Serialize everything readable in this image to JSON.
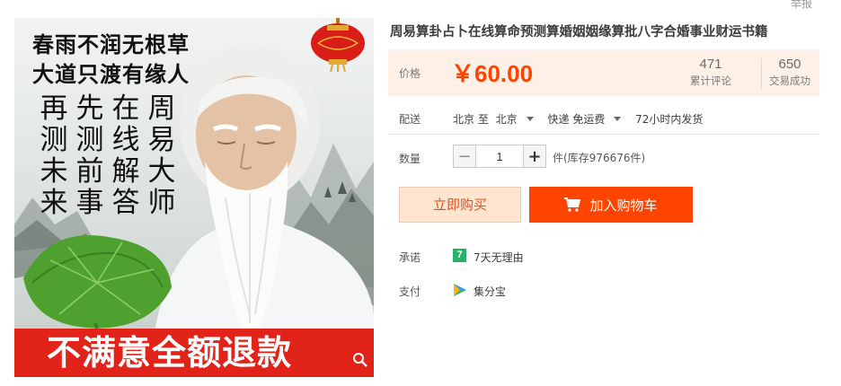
{
  "header": {
    "report_link": "举报"
  },
  "image": {
    "slogan_lines": [
      "春雨不润无根草",
      "大道只渡有缘人"
    ],
    "poem_columns": [
      "再测未来",
      "先测前事",
      "在线解答",
      "周易大师"
    ],
    "banner": "不满意全额退款",
    "icons": [
      "lantern-icon",
      "zoom-icon"
    ]
  },
  "product": {
    "title": "周易算卦占卜在线算命预测算婚姻姻缘算批八字合婚事业财运书籍",
    "price_label": "价格",
    "price": "￥60.00",
    "reviews_count": "471",
    "reviews_label": "累计评论",
    "sales_count": "650",
    "sales_label": "交易成功"
  },
  "shipping": {
    "label": "配送",
    "from": "北京 至",
    "to": "北京",
    "method": "快递 免运费",
    "dispatch": "72小时内发货"
  },
  "quantity": {
    "label": "数量",
    "minus": "−",
    "value": "1",
    "plus": "+",
    "stock_text": "件(库存976676件)"
  },
  "actions": {
    "buy_now": "立即购买",
    "add_to_cart": "加入购物车"
  },
  "services": {
    "promise_label": "承诺",
    "promise_icon_text": "7",
    "promise_text": "7天无理由",
    "payment_label": "支付",
    "payment_text": "集分宝"
  },
  "colors": {
    "accent": "#ff4400",
    "price": "#ff4400",
    "price_bg": "#fdf0e6",
    "banner_red": "#e2231a",
    "promise_green": "#27b267"
  }
}
